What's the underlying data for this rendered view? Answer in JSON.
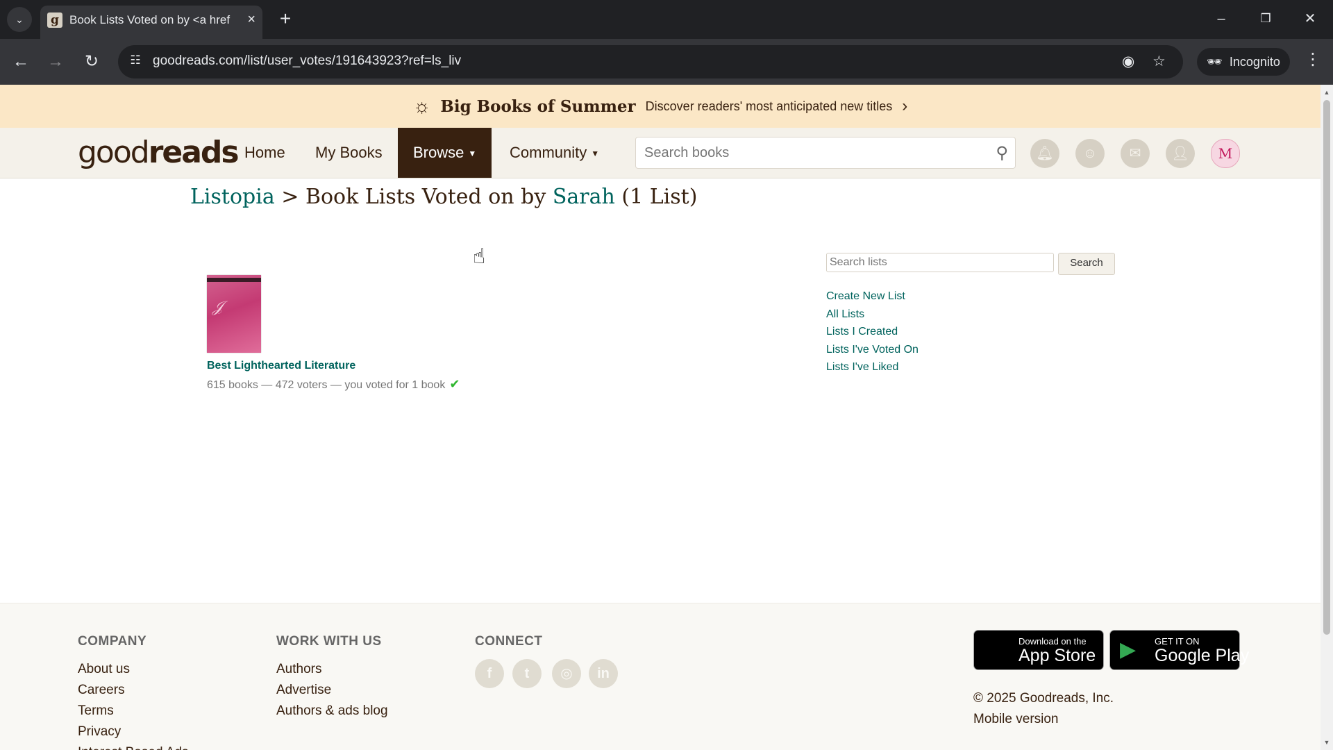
{
  "browser": {
    "tab": {
      "title": "Book Lists Voted on by <a href",
      "favicon": "g",
      "close_glyph": "×"
    },
    "new_tab_glyph": "+",
    "url": "goodreads.com/list/user_votes/191643923?ref=ls_liv",
    "incognito_label": "Incognito",
    "window_buttons": {
      "minimize": "–",
      "restore": "❐",
      "close": "✕"
    }
  },
  "promo": {
    "title": "Big Books of Summer",
    "subtitle": "Discover readers' most anticipated new titles",
    "chevron": "›"
  },
  "header": {
    "logo_light": "good",
    "logo_bold": "reads",
    "nav": [
      {
        "label": "Home"
      },
      {
        "label": "My Books"
      },
      {
        "label": "Browse",
        "caret": "▼"
      },
      {
        "label": "Community",
        "caret": "▼"
      }
    ],
    "search_placeholder": "Search books",
    "avatar_initial": "M"
  },
  "page": {
    "breadcrumb_root": "Listopia",
    "sep": " > ",
    "title_prefix": "Book Lists Voted on by ",
    "user_name": "Sarah",
    "count": " (1 List)"
  },
  "lists": [
    {
      "name": "Best Lighthearted Literature",
      "meta": "615 books — 472 voters — you voted for 1 book",
      "check": "✔",
      "cover_script": "Romeo Juliet"
    }
  ],
  "sidebar": {
    "search_placeholder": "Search lists",
    "search_button": "Search",
    "links": [
      "Create New List",
      "All Lists",
      "Lists I Created",
      "Lists I've Voted On",
      "Lists I've Liked"
    ]
  },
  "footer": {
    "company": {
      "heading": "COMPANY",
      "links": [
        "About us",
        "Careers",
        "Terms",
        "Privacy",
        "Interest Based Ads"
      ]
    },
    "work": {
      "heading": "WORK WITH US",
      "links": [
        "Authors",
        "Advertise",
        "Authors & ads blog"
      ]
    },
    "connect": {
      "heading": "CONNECT",
      "icons": [
        "f",
        "t",
        "◎",
        "in"
      ]
    },
    "app_store": {
      "small": "Download on the",
      "big": "App Store"
    },
    "google_play": {
      "small": "GET IT ON",
      "big": "Google Play"
    },
    "copyright": "© 2025 Goodreads, Inc.",
    "mobile": "Mobile version"
  },
  "colors": {
    "brand_brown": "#382110",
    "link_green": "#00635d",
    "header_bg": "#f4f1ea",
    "promo_bg": "#fbe7c6"
  }
}
